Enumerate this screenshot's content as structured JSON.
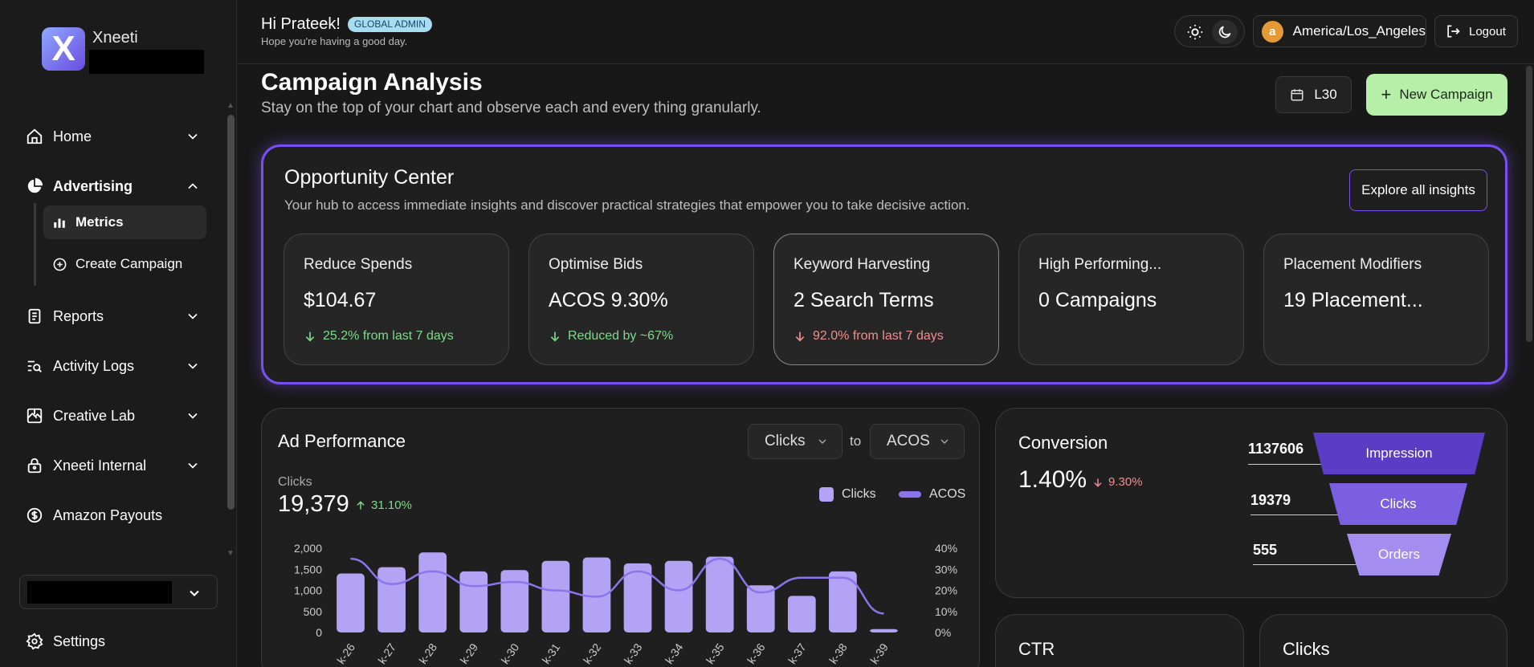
{
  "brand": {
    "name": "Xneeti",
    "logo_letter": "X"
  },
  "header": {
    "greeting": "Hi Prateek!",
    "role_badge": "GLOBAL ADMIN",
    "subtitle": "Hope you're having a good day.",
    "timezone": "America/Los_Angeles",
    "timezone_icon_letter": "a",
    "logout_label": "Logout"
  },
  "sidebar": {
    "items": [
      {
        "label": "Home"
      },
      {
        "label": "Advertising"
      },
      {
        "label": "Reports"
      },
      {
        "label": "Activity Logs"
      },
      {
        "label": "Creative Lab"
      },
      {
        "label": "Xneeti Internal"
      },
      {
        "label": "Amazon Payouts"
      },
      {
        "label": "Settings"
      }
    ],
    "sub_items": [
      {
        "label": "Metrics"
      },
      {
        "label": "Create Campaign"
      }
    ]
  },
  "page": {
    "title": "Campaign Analysis",
    "subtitle": "Stay on the top of your chart and observe each and every thing granularly.",
    "range_label": "L30",
    "new_campaign_label": "New Campaign"
  },
  "opportunity": {
    "title": "Opportunity Center",
    "subtitle": "Your hub to access immediate insights and discover practical strategies that empower you to take decisive action.",
    "explore_label": "Explore all insights",
    "cards": [
      {
        "title": "Reduce Spends",
        "value": "$104.67",
        "delta": "25.2% from last 7 days",
        "trend": "down-good"
      },
      {
        "title": "Optimise Bids",
        "value": "ACOS 9.30%",
        "delta": "Reduced by ~67%",
        "trend": "down-good"
      },
      {
        "title": "Keyword Harvesting",
        "value": "2 Search Terms",
        "delta": "92.0% from last 7 days",
        "trend": "down-bad"
      },
      {
        "title": "High Performing...",
        "value": "0 Campaigns",
        "delta": "",
        "trend": ""
      },
      {
        "title": "Placement Modifiers",
        "value": "19 Placement...",
        "delta": "",
        "trend": ""
      }
    ]
  },
  "ad_performance": {
    "title": "Ad Performance",
    "metric_a": "Clicks",
    "to_label": "to",
    "metric_b": "ACOS",
    "metric_label": "Clicks",
    "metric_value": "19,379",
    "metric_delta": "31.10%",
    "legend_bars": "Clicks",
    "legend_line": "ACOS"
  },
  "chart_data": {
    "type": "bar",
    "categories": [
      "k-26",
      "k-27",
      "k-28",
      "k-29",
      "k-30",
      "k-31",
      "k-32",
      "k-33",
      "k-34",
      "k-35",
      "k-36",
      "k-37",
      "k-38",
      "k-39"
    ],
    "series": [
      {
        "name": "Clicks",
        "values": [
          1400,
          1550,
          1900,
          1450,
          1480,
          1700,
          1780,
          1640,
          1700,
          1800,
          1120,
          870,
          1450,
          80
        ]
      },
      {
        "name": "ACOS",
        "values": [
          35,
          23,
          29,
          22,
          24,
          20,
          17,
          29,
          20,
          35,
          19,
          26,
          26,
          9
        ]
      }
    ],
    "y_left_ticks": [
      "2,000",
      "1,500",
      "1,000",
      "500",
      "0"
    ],
    "y_right_ticks": [
      "40%",
      "30%",
      "20%",
      "10%",
      "0%"
    ],
    "ylim_left": [
      0,
      2000
    ],
    "ylim_right": [
      0,
      40
    ],
    "bar_color": "#b3a3f5",
    "line_color": "#8a76ea"
  },
  "conversion": {
    "title": "Conversion",
    "value": "1.40%",
    "delta": "9.30%",
    "funnel": [
      {
        "label": "Impression",
        "value": "1137606",
        "color": "#5a3dc4"
      },
      {
        "label": "Clicks",
        "value": "19379",
        "color": "#7a5fe0"
      },
      {
        "label": "Orders",
        "value": "555",
        "color": "#a38ef0"
      }
    ]
  },
  "bottom_cards": [
    {
      "title": "CTR"
    },
    {
      "title": "Clicks"
    }
  ],
  "colors": {
    "accent": "#7a4ff0",
    "primary_button": "#b6efa8",
    "positive": "#7fd98a",
    "negative": "#ef8f8f"
  }
}
